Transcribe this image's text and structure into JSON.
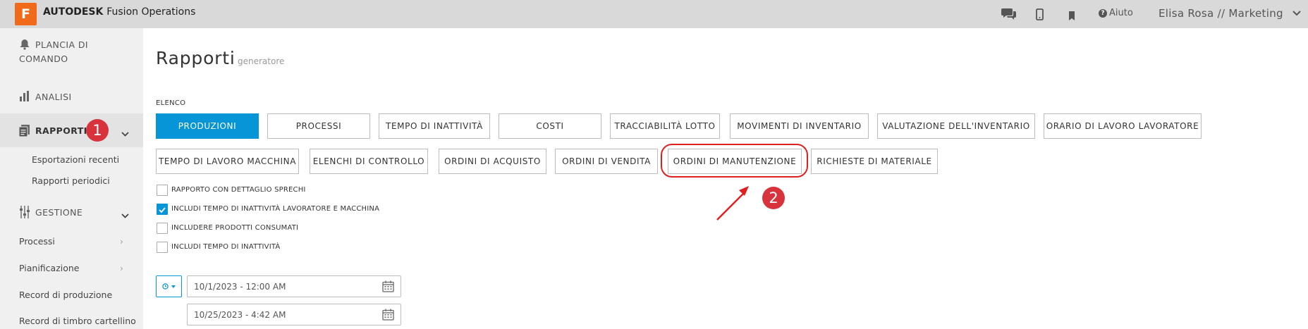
{
  "topbar": {
    "logo_letter": "F",
    "brand_bold": "AUTODESK",
    "brand_rest": "Fusion Operations",
    "help_label": "Aiuto",
    "user_label": "Elisa Rosa // Marketing",
    "icons": [
      "chat-icon",
      "mobile-icon",
      "bookmark-icon",
      "question-icon",
      "chevron-down-icon"
    ]
  },
  "sidebar": {
    "dashboard_line1": "PLANCIA DI",
    "dashboard_line2": "COMANDO",
    "analysis": "ANALISI",
    "reports": "RAPPORTI",
    "reports_sub": [
      "Esportazioni recenti",
      "Rapporti periodici"
    ],
    "management": "GESTIONE",
    "management_items": [
      "Processi",
      "Pianificazione",
      "Record di produzione",
      "Record di timbro cartellino"
    ]
  },
  "annotations": {
    "step1": "1",
    "step2": "2"
  },
  "main": {
    "title": "Rapporti",
    "subtitle": "generatore",
    "list_label": "ELENCO",
    "report_buttons": [
      "PRODUZIONI",
      "PROCESSI",
      "TEMPO DI INATTIVITÀ",
      "COSTI",
      "TRACCIABILITÀ LOTTO",
      "MOVIMENTI DI INVENTARIO",
      "VALUTAZIONE DELL'INVENTARIO",
      "ORARIO DI LAVORO LAVORATORE",
      "TEMPO DI LAVORO MACCHINA",
      "ELENCHI DI CONTROLLO",
      "ORDINI DI ACQUISTO",
      "ORDINI DI VENDITA",
      "ORDINI DI MANUTENZIONE",
      "RICHIESTE DI MATERIALE"
    ],
    "selected_report": "PRODUZIONI",
    "options": [
      {
        "label": "RAPPORTO CON DETTAGLIO SPRECHI",
        "checked": false
      },
      {
        "label": "INCLUDI TEMPO DI INATTIVITÀ LAVORATORE E MACCHINA",
        "checked": true
      },
      {
        "label": "INCLUDERE PRODOTTI CONSUMATI",
        "checked": false
      },
      {
        "label": "INCLUDI TEMPO DI INATTIVITÀ",
        "checked": false
      }
    ],
    "date_from": "10/1/2023 - 12:00 AM",
    "date_to": "10/25/2023 - 4:42 AM"
  },
  "colors": {
    "primary": "#0696d7",
    "brand_orange": "#f06a19",
    "annotation_red": "#d8323c"
  }
}
